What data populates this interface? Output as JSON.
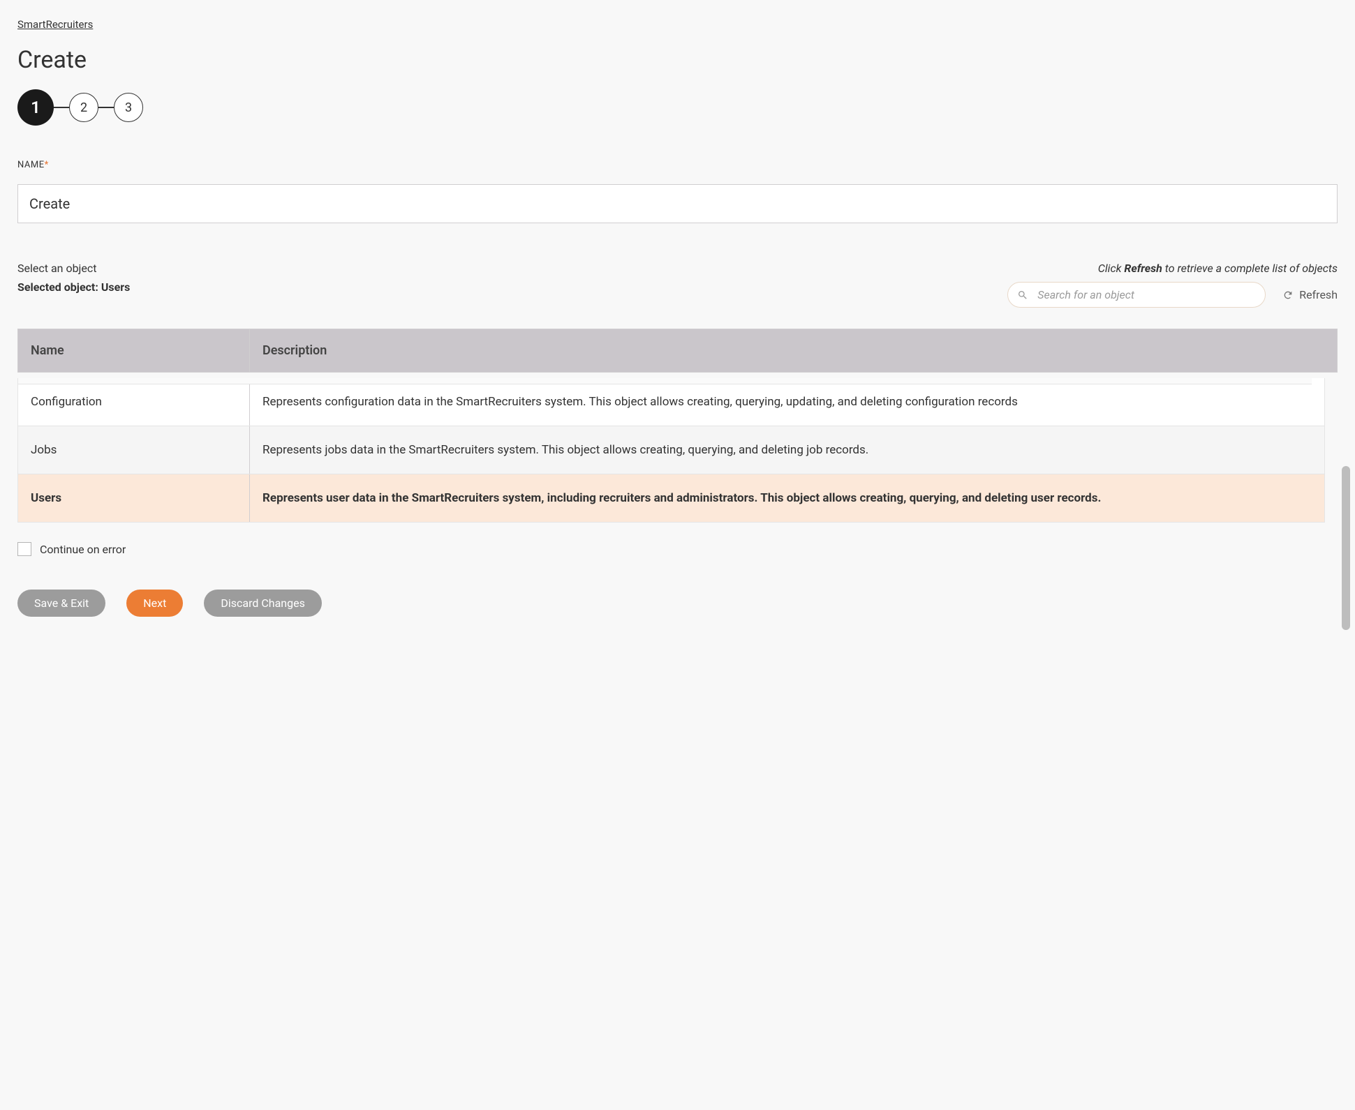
{
  "breadcrumb": "SmartRecruiters",
  "page_title": "Create",
  "stepper": {
    "steps": [
      "1",
      "2",
      "3"
    ],
    "current_index": 0
  },
  "name_field": {
    "label": "NAME",
    "required": "*",
    "value": "Create"
  },
  "object_section": {
    "select_hint": "Select an object",
    "selected_prefix": "Selected object: ",
    "selected_value": "Users",
    "refresh_hint_pre": "Click ",
    "refresh_hint_bold": "Refresh",
    "refresh_hint_post": " to retrieve a complete list of objects",
    "search_placeholder": "Search for an object",
    "refresh_label": "Refresh"
  },
  "table": {
    "headers": {
      "name": "Name",
      "description": "Description"
    },
    "rows": [
      {
        "name": "Configuration",
        "description": "Represents configuration data in the SmartRecruiters system. This object allows creating, querying, updating, and deleting configuration records",
        "selected": false
      },
      {
        "name": "Jobs",
        "description": "Represents jobs data in the SmartRecruiters system. This object allows creating, querying, and deleting job records.",
        "selected": false
      },
      {
        "name": "Users",
        "description": "Represents user data in the SmartRecruiters system, including recruiters and administrators. This object allows creating, querying, and deleting user records.",
        "selected": true
      }
    ]
  },
  "continue_on_error_label": "Continue on error",
  "buttons": {
    "save_exit": "Save & Exit",
    "next": "Next",
    "discard": "Discard Changes"
  }
}
